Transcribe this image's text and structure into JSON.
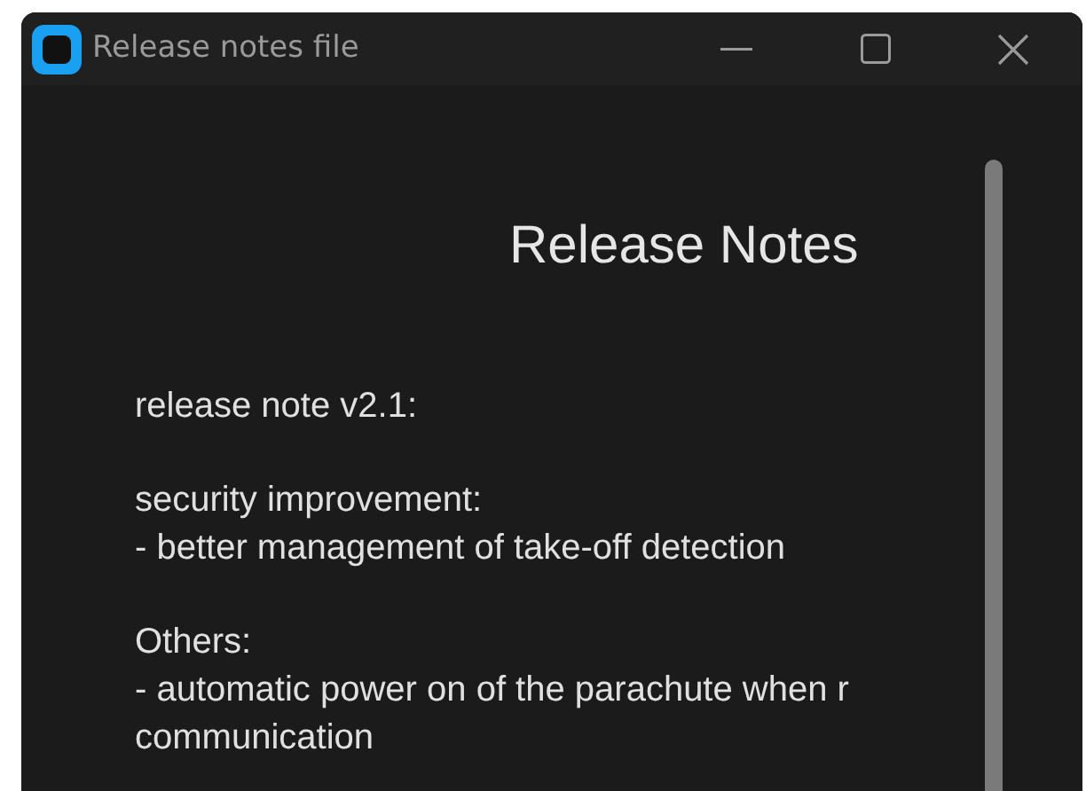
{
  "window": {
    "title": "Release notes file"
  },
  "heading": "Release Notes",
  "blocks": [
    {
      "lines": [
        "release note v2.1:"
      ]
    },
    {
      "lines": [
        "security improvement:",
        "- better management of take-off detection"
      ]
    },
    {
      "lines": [
        "Others:",
        "- automatic power on of the parachute when r",
        "communication"
      ]
    }
  ]
}
